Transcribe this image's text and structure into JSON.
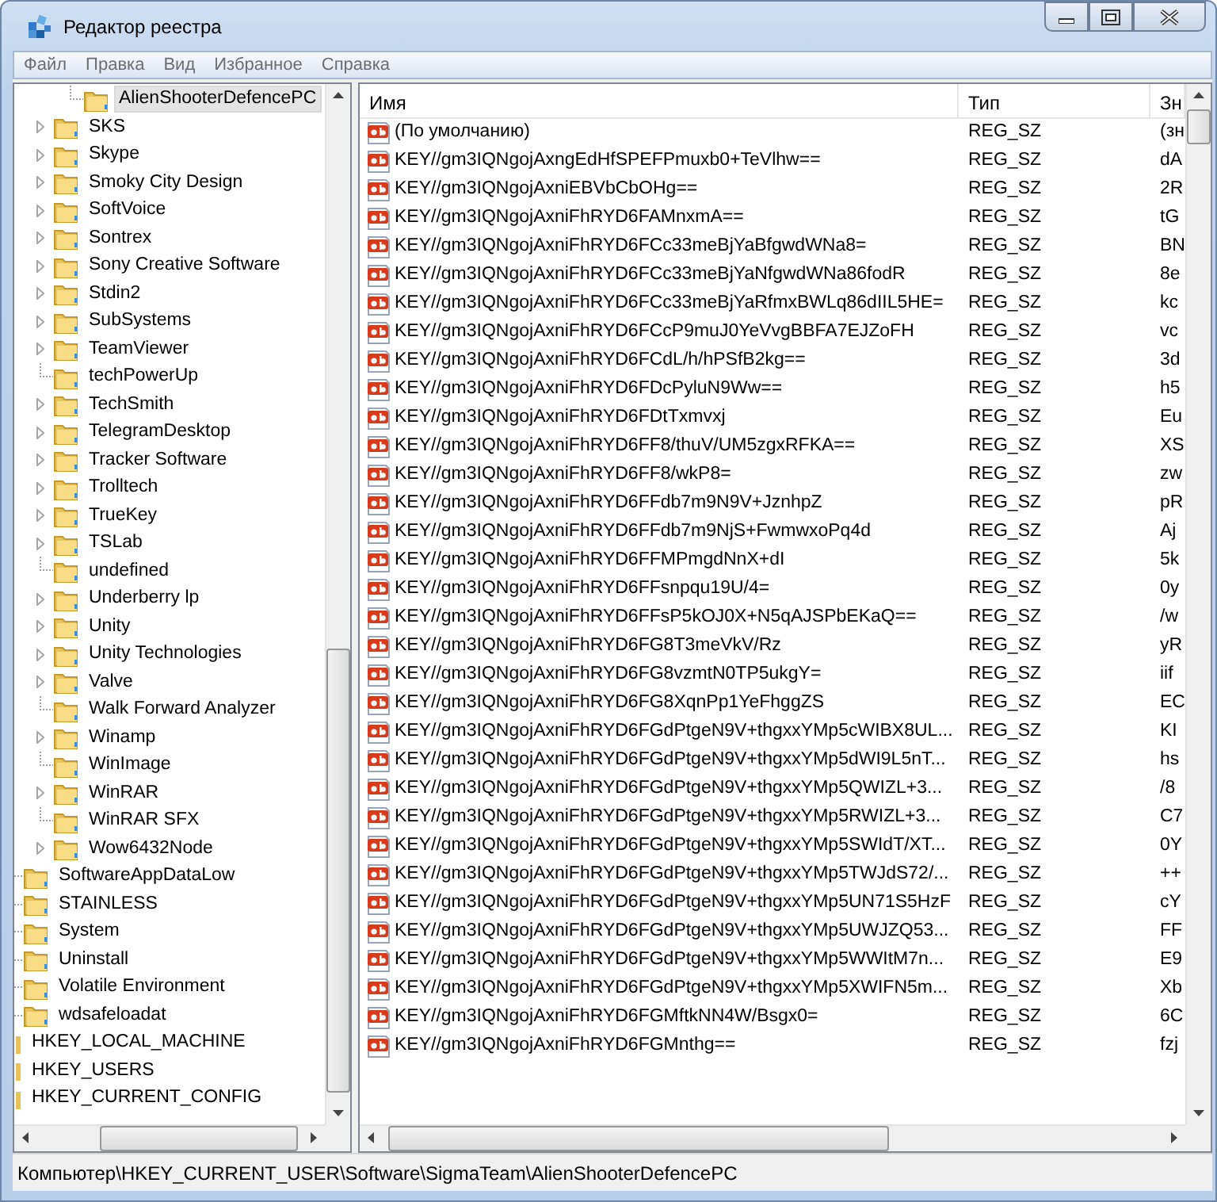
{
  "window": {
    "title": "Редактор реестра"
  },
  "menu": [
    "Файл",
    "Правка",
    "Вид",
    "Избранное",
    "Справка"
  ],
  "tree": [
    {
      "children": [
        {
          "children": [
            {
              "children": [
                {
                  "label": "AlienShooterDefencePC",
                  "selected": true,
                  "has_children": false
                }
              ]
            },
            {
              "label": "SKS",
              "selected": false,
              "has_children": true
            },
            {
              "label": "Skype",
              "selected": false,
              "has_children": true
            },
            {
              "label": "Smoky City Design",
              "selected": false,
              "has_children": true
            },
            {
              "label": "SoftVoice",
              "selected": false,
              "has_children": true
            },
            {
              "label": "Sontrex",
              "selected": false,
              "has_children": true
            },
            {
              "label": "Sony Creative Software",
              "selected": false,
              "has_children": true
            },
            {
              "label": "Stdin2",
              "selected": false,
              "has_children": true
            },
            {
              "label": "SubSystems",
              "selected": false,
              "has_children": true
            },
            {
              "label": "TeamViewer",
              "selected": false,
              "has_children": true
            },
            {
              "label": "techPowerUp",
              "selected": false,
              "has_children": false
            },
            {
              "label": "TechSmith",
              "selected": false,
              "has_children": true
            },
            {
              "label": "TelegramDesktop",
              "selected": false,
              "has_children": true
            },
            {
              "label": "Tracker Software",
              "selected": false,
              "has_children": true
            },
            {
              "label": "Trolltech",
              "selected": false,
              "has_children": true
            },
            {
              "label": "TrueKey",
              "selected": false,
              "has_children": true
            },
            {
              "label": "TSLab",
              "selected": false,
              "has_children": true
            },
            {
              "label": "undefined",
              "selected": false,
              "has_children": false
            },
            {
              "label": "Underberry lp",
              "selected": false,
              "has_children": true
            },
            {
              "label": "Unity",
              "selected": false,
              "has_children": true
            },
            {
              "label": "Unity Technologies",
              "selected": false,
              "has_children": true
            },
            {
              "label": "Valve",
              "selected": false,
              "has_children": true
            },
            {
              "label": "Walk Forward Analyzer",
              "selected": false,
              "has_children": false
            },
            {
              "label": "Winamp",
              "selected": false,
              "has_children": true
            },
            {
              "label": "WinImage",
              "selected": false,
              "has_children": false
            },
            {
              "label": "WinRAR",
              "selected": false,
              "has_children": true
            },
            {
              "label": "WinRAR SFX",
              "selected": false,
              "has_children": false
            },
            {
              "label": "Wow6432Node",
              "selected": false,
              "has_children": true
            }
          ]
        },
        {
          "label": "SoftwareAppDataLow",
          "selected": false
        },
        {
          "label": "STAINLESS",
          "selected": false
        },
        {
          "label": "System",
          "selected": false
        },
        {
          "label": "Uninstall",
          "selected": false
        },
        {
          "label": "Volatile Environment",
          "selected": false
        },
        {
          "label": "wdsafeloadat",
          "selected": false
        }
      ]
    },
    {
      "label": "HKEY_LOCAL_MACHINE",
      "selected": false
    },
    {
      "label": "HKEY_USERS",
      "selected": false
    },
    {
      "label": "HKEY_CURRENT_CONFIG",
      "selected": false
    }
  ],
  "list": {
    "columns": [
      "Имя",
      "Тип",
      "Зн"
    ],
    "rows": [
      {
        "name": "(По умолчанию)",
        "type": "REG_SZ",
        "value": "(зн"
      },
      {
        "name": "KEY//gm3IQNgojAxngEdHfSPEFPmuxb0+TeVlhw==",
        "type": "REG_SZ",
        "value": "dA"
      },
      {
        "name": "KEY//gm3IQNgojAxniEBVbCbOHg==",
        "type": "REG_SZ",
        "value": "2R"
      },
      {
        "name": "KEY//gm3IQNgojAxniFhRYD6FAMnxmA==",
        "type": "REG_SZ",
        "value": "tG"
      },
      {
        "name": "KEY//gm3IQNgojAxniFhRYD6FCc33meBjYaBfgwdWNa8=",
        "type": "REG_SZ",
        "value": "BN"
      },
      {
        "name": "KEY//gm3IQNgojAxniFhRYD6FCc33meBjYaNfgwdWNa86fodR",
        "type": "REG_SZ",
        "value": "8e"
      },
      {
        "name": "KEY//gm3IQNgojAxniFhRYD6FCc33meBjYaRfmxBWLq86dIIL5HE=",
        "type": "REG_SZ",
        "value": "kc"
      },
      {
        "name": "KEY//gm3IQNgojAxniFhRYD6FCcP9muJ0YeVvgBBFA7EJZoFH",
        "type": "REG_SZ",
        "value": "vc"
      },
      {
        "name": "KEY//gm3IQNgojAxniFhRYD6FCdL/h/hPSfB2kg==",
        "type": "REG_SZ",
        "value": "3d"
      },
      {
        "name": "KEY//gm3IQNgojAxniFhRYD6FDcPyluN9Ww==",
        "type": "REG_SZ",
        "value": "h5"
      },
      {
        "name": "KEY//gm3IQNgojAxniFhRYD6FDtTxmvxj",
        "type": "REG_SZ",
        "value": "Eu"
      },
      {
        "name": "KEY//gm3IQNgojAxniFhRYD6FF8/thuV/UM5zgxRFKA==",
        "type": "REG_SZ",
        "value": "XS"
      },
      {
        "name": "KEY//gm3IQNgojAxniFhRYD6FF8/wkP8=",
        "type": "REG_SZ",
        "value": "zw"
      },
      {
        "name": "KEY//gm3IQNgojAxniFhRYD6FFdb7m9N9V+JznhpZ",
        "type": "REG_SZ",
        "value": "pR"
      },
      {
        "name": "KEY//gm3IQNgojAxniFhRYD6FFdb7m9NjS+FwmwxoPq4d",
        "type": "REG_SZ",
        "value": "Aj"
      },
      {
        "name": "KEY//gm3IQNgojAxniFhRYD6FFMPmgdNnX+dI",
        "type": "REG_SZ",
        "value": "5k"
      },
      {
        "name": "KEY//gm3IQNgojAxniFhRYD6FFsnpqu19U/4=",
        "type": "REG_SZ",
        "value": "0y"
      },
      {
        "name": "KEY//gm3IQNgojAxniFhRYD6FFsP5kOJ0X+N5qAJSPbEKaQ==",
        "type": "REG_SZ",
        "value": "/w"
      },
      {
        "name": "KEY//gm3IQNgojAxniFhRYD6FG8T3meVkV/Rz",
        "type": "REG_SZ",
        "value": "yR"
      },
      {
        "name": "KEY//gm3IQNgojAxniFhRYD6FG8vzmtN0TP5ukgY=",
        "type": "REG_SZ",
        "value": "iif"
      },
      {
        "name": "KEY//gm3IQNgojAxniFhRYD6FG8XqnPp1YeFhggZS",
        "type": "REG_SZ",
        "value": "EC"
      },
      {
        "name": "KEY//gm3IQNgojAxniFhRYD6FGdPtgeN9V+thgxxYMp5cWIBX8UL...",
        "type": "REG_SZ",
        "value": "KI"
      },
      {
        "name": "KEY//gm3IQNgojAxniFhRYD6FGdPtgeN9V+thgxxYMp5dWI9L5nT...",
        "type": "REG_SZ",
        "value": "hs"
      },
      {
        "name": "KEY//gm3IQNgojAxniFhRYD6FGdPtgeN9V+thgxxYMp5QWIZL+3...",
        "type": "REG_SZ",
        "value": "/8"
      },
      {
        "name": "KEY//gm3IQNgojAxniFhRYD6FGdPtgeN9V+thgxxYMp5RWIZL+3...",
        "type": "REG_SZ",
        "value": "C7"
      },
      {
        "name": "KEY//gm3IQNgojAxniFhRYD6FGdPtgeN9V+thgxxYMp5SWIdT/XT...",
        "type": "REG_SZ",
        "value": "0Y"
      },
      {
        "name": "KEY//gm3IQNgojAxniFhRYD6FGdPtgeN9V+thgxxYMp5TWJdS72/...",
        "type": "REG_SZ",
        "value": "++"
      },
      {
        "name": "KEY//gm3IQNgojAxniFhRYD6FGdPtgeN9V+thgxxYMp5UN71S5HzF",
        "type": "REG_SZ",
        "value": "cY"
      },
      {
        "name": "KEY//gm3IQNgojAxniFhRYD6FGdPtgeN9V+thgxxYMp5UWJZQ53...",
        "type": "REG_SZ",
        "value": "FF"
      },
      {
        "name": "KEY//gm3IQNgojAxniFhRYD6FGdPtgeN9V+thgxxYMp5WWItM7n...",
        "type": "REG_SZ",
        "value": "E9"
      },
      {
        "name": "KEY//gm3IQNgojAxniFhRYD6FGdPtgeN9V+thgxxYMp5XWIFN5m...",
        "type": "REG_SZ",
        "value": "Xb"
      },
      {
        "name": "KEY//gm3IQNgojAxniFhRYD6FGMftkNN4W/Bsgx0=",
        "type": "REG_SZ",
        "value": "6C"
      },
      {
        "name": "KEY//gm3IQNgojAxniFhRYD6FGMnthg==",
        "type": "REG_SZ",
        "value": "fzj"
      }
    ]
  },
  "status_bar": "Компьютер\\HKEY_CURRENT_USER\\Software\\SigmaTeam\\AlienShooterDefencePC"
}
